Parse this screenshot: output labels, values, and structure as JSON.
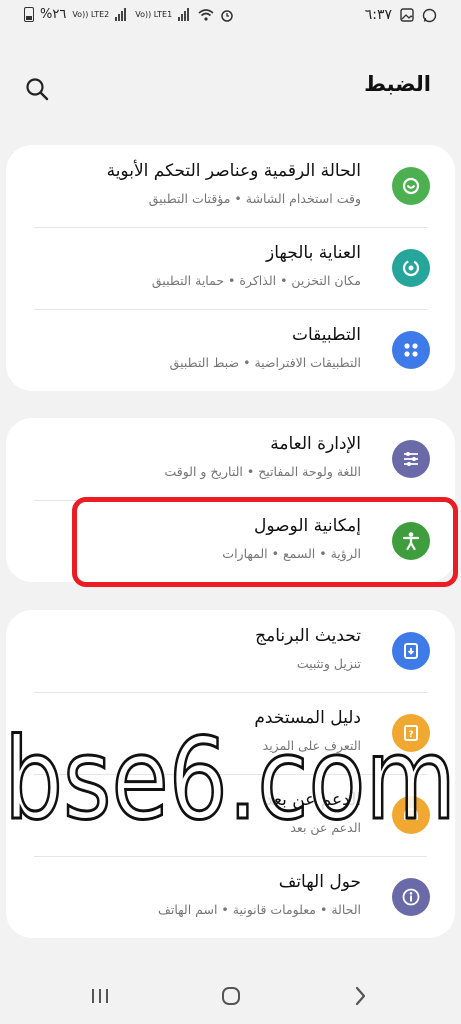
{
  "status_bar": {
    "battery": "%٢٦",
    "sim2": "Vo)) LTE2",
    "sim1": "Vo)) LTE1",
    "time": "٦:٣٧"
  },
  "header": {
    "title": "الضبط",
    "search_icon": "search-icon"
  },
  "cards": [
    {
      "items": [
        {
          "title": "الحالة الرقمية وعناصر التحكم الأبوية",
          "subtitle": "وقت استخدام الشاشة • مؤقتات التطبيق",
          "icon": "digital-wellbeing-icon",
          "color": "#4caf50"
        },
        {
          "title": "العناية بالجهاز",
          "subtitle": "مكان التخزين • الذاكرة • حماية التطبيق",
          "icon": "device-care-icon",
          "color": "#26a69a"
        },
        {
          "title": "التطبيقات",
          "subtitle": "التطبيقات الافتراضية • ضبط التطبيق",
          "icon": "apps-icon",
          "color": "#3f7be8"
        }
      ]
    },
    {
      "items": [
        {
          "title": "الإدارة العامة",
          "subtitle": "اللغة ولوحة المفاتيح • التاريخ و الوقت",
          "icon": "general-management-icon",
          "color": "#6a6aa8"
        },
        {
          "title": "إمكانية الوصول",
          "subtitle": "الرؤية • السمع • المهارات",
          "icon": "accessibility-icon",
          "color": "#3e9e3e"
        }
      ]
    },
    {
      "items": [
        {
          "title": "تحديث البرنامج",
          "subtitle": "تنزيل وتثبيت",
          "icon": "software-update-icon",
          "color": "#3f7be8"
        },
        {
          "title": "دليل المستخدم",
          "subtitle": "التعرف على المزيد",
          "icon": "user-manual-icon",
          "color": "#f0a830"
        },
        {
          "title": "الدعم عن بعد",
          "subtitle": "الدعم عن بعد",
          "icon": "remote-support-icon",
          "color": "#f0a830"
        },
        {
          "title": "حول الهاتف",
          "subtitle": "الحالة • معلومات قانونية • اسم الهاتف",
          "icon": "about-phone-icon",
          "color": "#6a6aa8"
        }
      ]
    }
  ],
  "watermark": "bse6.com",
  "nav": {
    "recents": "recents-icon",
    "home": "home-icon",
    "back": "back-icon"
  }
}
